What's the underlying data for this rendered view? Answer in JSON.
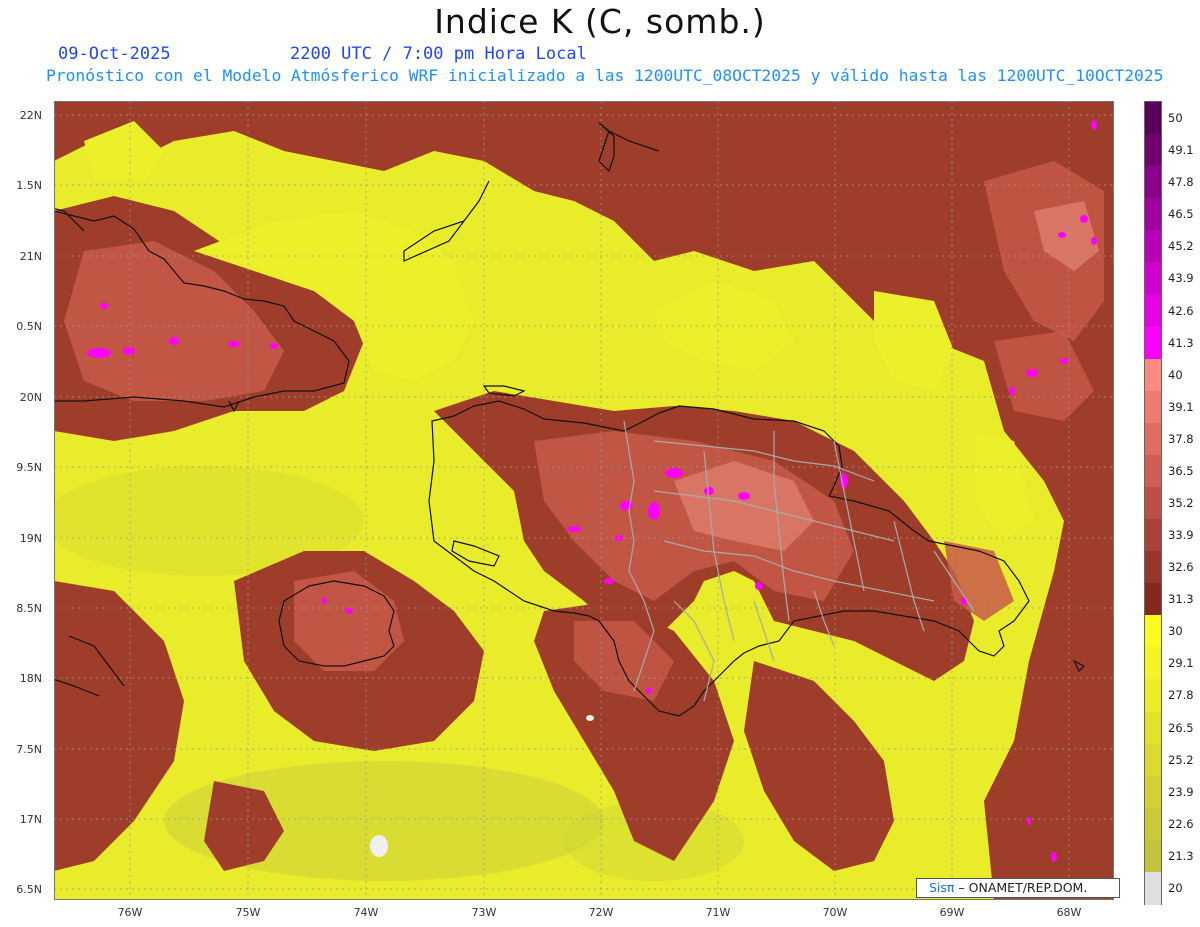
{
  "header": {
    "title": "Indice K (C, somb.)",
    "date": "09-Oct-2025",
    "time": "2200 UTC / 7:00 pm Hora Local",
    "model_line": "Pronóstico con el Modelo Atmósferico WRF inicializado a las 1200UTC_08OCT2025 y válido hasta las  1200UTC_10OCT2025"
  },
  "map": {
    "lat_labels": [
      "22N",
      "1.5N",
      "21N",
      "0.5N",
      "20N",
      "9.5N",
      "19N",
      "8.5N",
      "18N",
      "7.5N",
      "17N",
      "6.5N"
    ],
    "lon_labels": [
      "76W",
      "75W",
      "74W",
      "73W",
      "72W",
      "71W",
      "70W",
      "69W",
      "68W"
    ],
    "colors": {
      "ocean_base": "#e8ec2a",
      "land_base": "#9e3e2a",
      "dark_brown": "#8b2d1e",
      "mid_red": "#c85a4a",
      "salmon": "#e08070",
      "magenta": "#ff00ff",
      "coast": "#111111",
      "border": "#aaaaaa"
    }
  },
  "colorbar": {
    "levels": [
      {
        "label": "50",
        "color": "#5a005a"
      },
      {
        "label": "49.1",
        "color": "#700070"
      },
      {
        "label": "47.8",
        "color": "#8a008a"
      },
      {
        "label": "46.5",
        "color": "#a000a0"
      },
      {
        "label": "45.2",
        "color": "#b800b8"
      },
      {
        "label": "43.9",
        "color": "#d000d0"
      },
      {
        "label": "42.6",
        "color": "#e600e6"
      },
      {
        "label": "41.3",
        "color": "#ff00ff"
      },
      {
        "label": "40",
        "color": "#ff8a80"
      },
      {
        "label": "39.1",
        "color": "#f07a70"
      },
      {
        "label": "37.8",
        "color": "#e06c62"
      },
      {
        "label": "36.5",
        "color": "#cf5e54"
      },
      {
        "label": "35.2",
        "color": "#bd5046"
      },
      {
        "label": "33.9",
        "color": "#ab4238"
      },
      {
        "label": "32.6",
        "color": "#99352b"
      },
      {
        "label": "31.3",
        "color": "#86281e"
      },
      {
        "label": "30",
        "color": "#fbfb20"
      },
      {
        "label": "29.1",
        "color": "#f4f424"
      },
      {
        "label": "27.8",
        "color": "#ecec28"
      },
      {
        "label": "26.5",
        "color": "#e3e32c"
      },
      {
        "label": "25.2",
        "color": "#dada30"
      },
      {
        "label": "23.9",
        "color": "#d2d234"
      },
      {
        "label": "22.6",
        "color": "#caca38"
      },
      {
        "label": "21.3",
        "color": "#c2c23c"
      },
      {
        "label": "20",
        "color": "#e0e0e0"
      }
    ]
  },
  "credit": {
    "logo": "Sisπ",
    "text": "– ONAMET/REP.DOM."
  }
}
